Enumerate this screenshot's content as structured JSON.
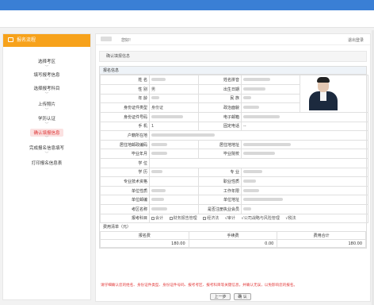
{
  "sidebar": {
    "title": "报名流程",
    "items": [
      "选择考区",
      "填写报考信息",
      "选择报考科目",
      "上传照片",
      "学历认证",
      "确认填报信息",
      "完成报名信息填写",
      "打印报名信息表"
    ]
  },
  "header": {
    "welcome": "您好!",
    "logout": "退出登录"
  },
  "breadcrumb": "确认填报信息",
  "form": {
    "section_title": "报名信息",
    "labels": {
      "name": "姓 名",
      "py_name": "姓名拼音",
      "gender": "性 别",
      "birthday": "出生日期",
      "age": "年 龄",
      "nation": "民 族",
      "id_type": "身份证件类型",
      "politics": "政治面貌",
      "id_no": "身份证件号码",
      "email": "电子邮箱",
      "mobile": "手 机",
      "phone": "固定电话",
      "origin": "户籍所在地",
      "zip": "居住地邮政编码",
      "address": "居住地地址",
      "grad_year": "毕业年月",
      "school": "毕业院校",
      "degree": "学 位",
      "edu": "学 历",
      "major": "专 业",
      "tech_title": "专业技术资格",
      "job_title": "职业性质",
      "work_unit": "单位性质",
      "work_years": "工作年限",
      "unit_zip": "单位邮编",
      "unit_addr": "单位地址",
      "area_name": "考区名称",
      "is_member": "是否注册执业会员",
      "subjects": "报考科目"
    },
    "values": {
      "gender": "男",
      "id_type": "身份证",
      "mobile": "1"
    },
    "subjects": [
      {
        "label": "会计",
        "checked": false
      },
      {
        "label": "财务报告管理",
        "checked": false
      },
      {
        "label": "经济法",
        "checked": false
      },
      {
        "label": "审计",
        "checked": true
      },
      {
        "label": "公司战略与风险管理",
        "checked": true
      },
      {
        "label": "税法",
        "checked": true
      }
    ]
  },
  "fees": {
    "section_title": "费用清单（元）",
    "headers": [
      "报名费",
      "手续费",
      "费用合计"
    ],
    "values": [
      "180.00",
      "0.00",
      "180.00"
    ]
  },
  "notice": "请仔细确认您的姓名、身份证件类型、身份证件号码、报考考区、报考科目等关键信息，并确认无误，以免影响您的报名。",
  "buttons": {
    "prev": "上一步",
    "confirm": "确 认"
  }
}
